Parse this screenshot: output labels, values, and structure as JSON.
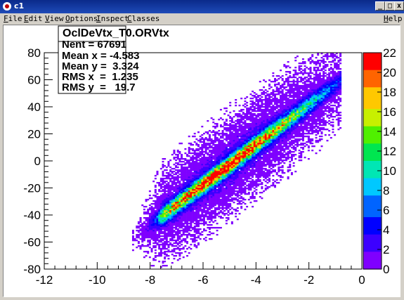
{
  "window": {
    "title": "c1",
    "icon": "root-logo-icon",
    "controls": [
      "_",
      "□",
      "x"
    ]
  },
  "menu": {
    "items": [
      "File",
      "Edit",
      "View",
      "Options",
      "Inspect",
      "Classes"
    ],
    "help": "Help"
  },
  "stats": {
    "title": "OclDeVtx_T0.ORVtx",
    "lines": [
      "Nent = 67691",
      "Mean x = -4.583",
      "Mean y =  3.324",
      "RMS x  =  1.235",
      "RMS y  =   19.7"
    ]
  },
  "chart_data": {
    "type": "heatmap",
    "x_ticks": [
      "-12",
      "-10",
      "-8",
      "-6",
      "-4",
      "-2",
      "0"
    ],
    "y_ticks": [
      "80",
      "60",
      "40",
      "20",
      "0",
      "-20",
      "-40",
      "-60",
      "-80"
    ],
    "xlim": [
      -12,
      0
    ],
    "ylim": [
      -80,
      80
    ],
    "z_ticks": [
      "22",
      "20",
      "18",
      "16",
      "14",
      "12",
      "10",
      "8",
      "6",
      "4",
      "2",
      "0"
    ],
    "zlim": [
      0,
      22
    ],
    "palette": [
      "#7f00ff",
      "#3c00ff",
      "#0000ff",
      "#0064ff",
      "#00c8ff",
      "#00e6b4",
      "#00e650",
      "#50f000",
      "#c8f000",
      "#ffc800",
      "#ff6400",
      "#ff0000"
    ],
    "distribution": {
      "entries": 67691,
      "mean_x": -4.583,
      "mean_y": 3.324,
      "rms_x": 1.235,
      "rms_y": 19.7
    }
  }
}
